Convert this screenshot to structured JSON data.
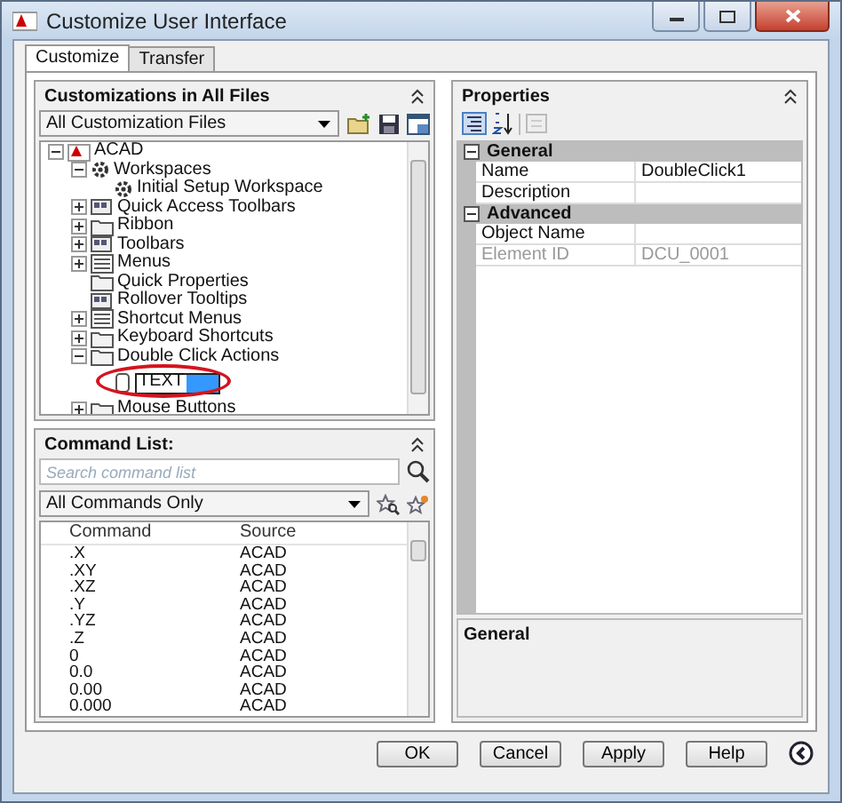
{
  "window": {
    "title": "Customize User Interface"
  },
  "tabs": [
    {
      "label": "Customize",
      "selected": true
    },
    {
      "label": "Transfer",
      "selected": false
    }
  ],
  "customizations": {
    "title": "Customizations in All Files",
    "file_filter": "All Customization Files",
    "tree": [
      {
        "label": "ACAD",
        "kind": "file",
        "expanded": true,
        "children": [
          {
            "label": "Workspaces",
            "kind": "gear",
            "expanded": true,
            "children": [
              {
                "label": "Initial Setup Workspace",
                "kind": "gear"
              }
            ]
          },
          {
            "label": "Quick Access Toolbars",
            "kind": "toolbar",
            "expanded": false
          },
          {
            "label": "Ribbon",
            "kind": "folder",
            "expanded": false
          },
          {
            "label": "Toolbars",
            "kind": "toolbar",
            "expanded": false
          },
          {
            "label": "Menus",
            "kind": "menu",
            "expanded": false
          },
          {
            "label": "Quick Properties",
            "kind": "folder"
          },
          {
            "label": "Rollover Tooltips",
            "kind": "toolbar"
          },
          {
            "label": "Shortcut Menus",
            "kind": "menu",
            "expanded": false
          },
          {
            "label": "Keyboard Shortcuts",
            "kind": "folder",
            "expanded": false
          },
          {
            "label": "Double Click Actions",
            "kind": "folder",
            "expanded": true,
            "children": [
              {
                "label": "TEXT",
                "kind": "edit"
              }
            ]
          },
          {
            "label": "Mouse Buttons",
            "kind": "folder",
            "expanded": false
          }
        ]
      }
    ]
  },
  "command_list": {
    "title": "Command List:",
    "search": {
      "placeholder": "Search command list"
    },
    "filter": "All Commands Only",
    "columns": [
      "Command",
      "Source"
    ],
    "rows": [
      [
        ".X",
        "ACAD"
      ],
      [
        ".XY",
        "ACAD"
      ],
      [
        ".XZ",
        "ACAD"
      ],
      [
        ".Y",
        "ACAD"
      ],
      [
        ".YZ",
        "ACAD"
      ],
      [
        ".Z",
        "ACAD"
      ],
      [
        "0",
        "ACAD"
      ],
      [
        "0.0",
        "ACAD"
      ],
      [
        "0.00",
        "ACAD"
      ],
      [
        "0.000",
        "ACAD"
      ]
    ]
  },
  "properties": {
    "title": "Properties",
    "categories": [
      {
        "name": "General",
        "expanded": true,
        "rows": [
          {
            "name": "Name",
            "value": "DoubleClick1",
            "disabled": false
          },
          {
            "name": "Description",
            "value": "",
            "disabled": false
          }
        ]
      },
      {
        "name": "Advanced",
        "expanded": true,
        "rows": [
          {
            "name": "Object Name",
            "value": "",
            "disabled": false
          },
          {
            "name": "Element ID",
            "value": "DCU_0001",
            "disabled": true
          }
        ]
      }
    ],
    "help_title": "General"
  },
  "buttons": [
    {
      "label": "OK"
    },
    {
      "label": "Cancel"
    },
    {
      "label": "Apply"
    },
    {
      "label": "Help"
    }
  ]
}
